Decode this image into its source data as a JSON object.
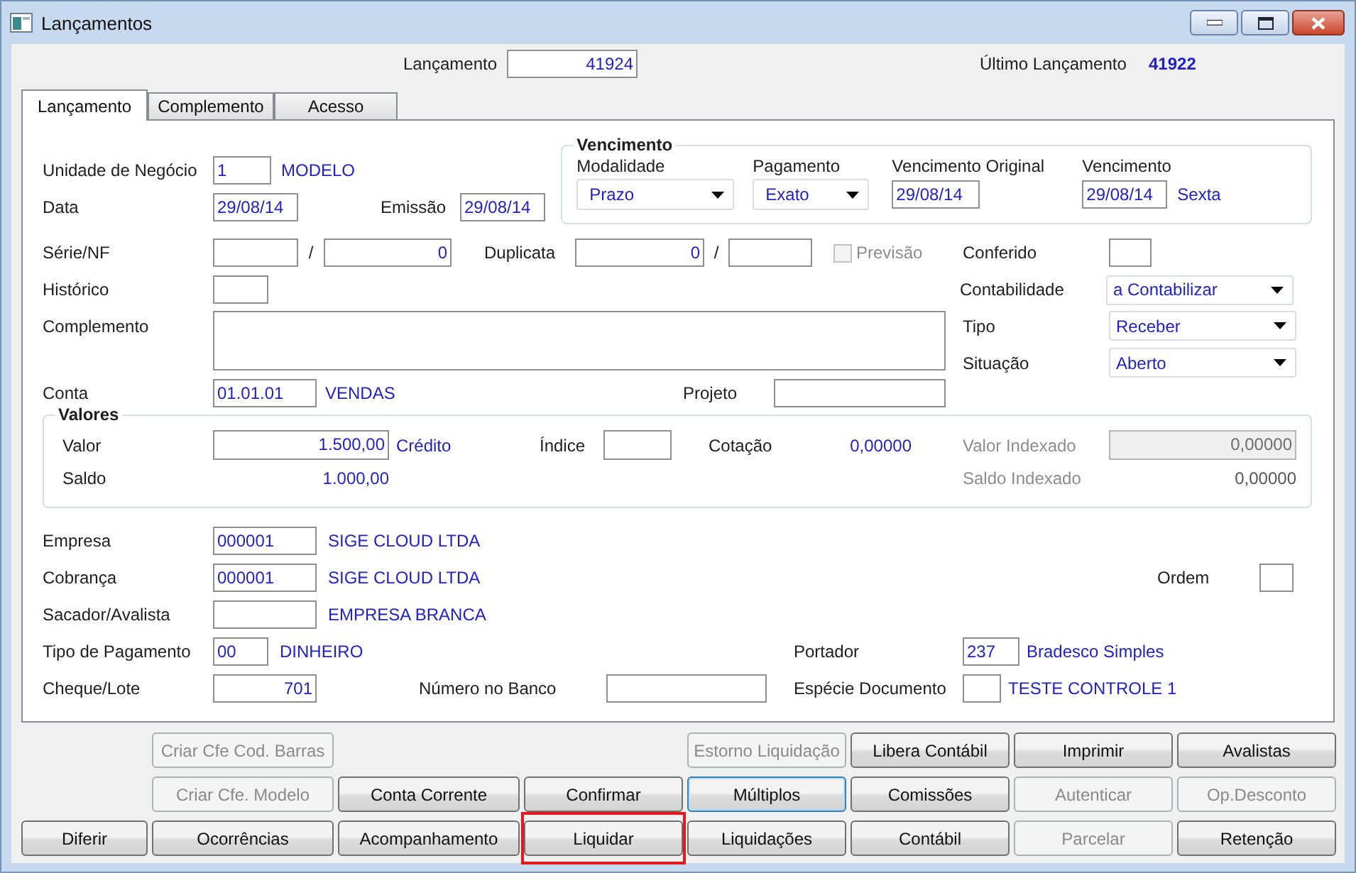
{
  "window": {
    "title": "Lançamentos"
  },
  "header": {
    "entry_label": "Lançamento",
    "entry_value": "41924",
    "last_label": "Último Lançamento",
    "last_value": "41922"
  },
  "tabs": [
    {
      "label": "Lançamento",
      "selected": true
    },
    {
      "label": "Complemento",
      "selected": false
    },
    {
      "label": "Acesso",
      "selected": false
    }
  ],
  "vencimento": {
    "title": "Vencimento",
    "modalidade_label": "Modalidade",
    "modalidade": "Prazo",
    "pagamento_label": "Pagamento",
    "pagamento": "Exato",
    "original_label": "Vencimento Original",
    "original": "29/08/14",
    "due_label": "Vencimento",
    "due": "29/08/14",
    "weekday": "Sexta"
  },
  "form": {
    "unidade": {
      "label": "Unidade de Negócio",
      "code": "1",
      "name": "MODELO"
    },
    "data": {
      "label": "Data",
      "value": "29/08/14"
    },
    "emissao": {
      "label": "Emissão",
      "value": "29/08/14"
    },
    "serie_nf": {
      "label": "Série/NF",
      "separator": "/",
      "nf": "0"
    },
    "duplicata": {
      "label": "Duplicata",
      "value": "0",
      "separator": "/"
    },
    "previsao": {
      "label": "Previsão",
      "checked": false,
      "disabled": true
    },
    "conferido": {
      "label": "Conferido"
    },
    "historico": {
      "label": "Histórico"
    },
    "contabilidade": {
      "label": "Contabilidade",
      "value": "a Contabilizar"
    },
    "complemento": {
      "label": "Complemento"
    },
    "tipo": {
      "label": "Tipo",
      "value": "Receber"
    },
    "situacao": {
      "label": "Situação",
      "value": "Aberto"
    },
    "conta": {
      "label": "Conta",
      "code": "01.01.01",
      "name": "VENDAS"
    },
    "projeto": {
      "label": "Projeto"
    }
  },
  "valores": {
    "title": "Valores",
    "valor_label": "Valor",
    "valor": "1.500,00",
    "valor_type": "Crédito",
    "indice_label": "Índice",
    "cotacao_label": "Cotação",
    "cotacao": "0,00000",
    "indexado_label": "Valor Indexado",
    "indexado": "0,00000",
    "indexado_disabled": true,
    "saldo_label": "Saldo",
    "saldo": "1.000,00",
    "saldo_indexado_label": "Saldo Indexado",
    "saldo_indexado": "0,00000"
  },
  "parties": {
    "empresa": {
      "label": "Empresa",
      "code": "000001",
      "name": "SIGE CLOUD LTDA"
    },
    "cobranca": {
      "label": "Cobrança",
      "code": "000001",
      "name": "SIGE CLOUD LTDA"
    },
    "ordem": {
      "label": "Ordem"
    },
    "sacador": {
      "label": "Sacador/Avalista",
      "name": "EMPRESA BRANCA"
    },
    "tipo_pagamento": {
      "label": "Tipo de Pagamento",
      "code": "00",
      "name": "DINHEIRO"
    },
    "portador": {
      "label": "Portador",
      "code": "237",
      "name": "Bradesco Simples"
    },
    "cheque": {
      "label": "Cheque/Lote",
      "value": "701"
    },
    "numero_banco": {
      "label": "Número no Banco"
    },
    "especie": {
      "label": "Espécie Documento",
      "name": "TESTE CONTROLE 1"
    }
  },
  "button_rows": [
    [
      {
        "label": "Criar Cfe Cod. Barras",
        "disabled": true,
        "focused": false,
        "highlighted": false
      },
      {
        "label": "Estorno Liquidação",
        "disabled": true,
        "focused": false,
        "highlighted": false
      },
      {
        "label": "Libera Contábil",
        "disabled": false,
        "focused": false,
        "highlighted": false
      },
      {
        "label": "Imprimir",
        "disabled": false,
        "focused": false,
        "highlighted": false
      },
      {
        "label": "Avalistas",
        "disabled": false,
        "focused": false,
        "highlighted": false
      }
    ],
    [
      {
        "label": "Criar Cfe. Modelo",
        "disabled": true,
        "focused": false,
        "highlighted": false
      },
      {
        "label": "Conta Corrente",
        "disabled": false,
        "focused": false,
        "highlighted": false
      },
      {
        "label": "Confirmar",
        "disabled": false,
        "focused": false,
        "highlighted": false
      },
      {
        "label": "Múltiplos",
        "disabled": false,
        "focused": true,
        "highlighted": false
      },
      {
        "label": "Comissões",
        "disabled": false,
        "focused": false,
        "highlighted": false
      },
      {
        "label": "Autenticar",
        "disabled": true,
        "focused": false,
        "highlighted": false
      },
      {
        "label": "Op.Desconto",
        "disabled": true,
        "focused": false,
        "highlighted": false
      }
    ],
    [
      {
        "label": "Diferir",
        "disabled": false,
        "focused": false,
        "highlighted": false
      },
      {
        "label": "Ocorrências",
        "disabled": false,
        "focused": false,
        "highlighted": false
      },
      {
        "label": "Acompanhamento",
        "disabled": false,
        "focused": false,
        "highlighted": false
      },
      {
        "label": "Liquidar",
        "disabled": false,
        "focused": false,
        "highlighted": true
      },
      {
        "label": "Liquidações",
        "disabled": false,
        "focused": false,
        "highlighted": false
      },
      {
        "label": "Contábil",
        "disabled": false,
        "focused": false,
        "highlighted": false
      },
      {
        "label": "Parcelar",
        "disabled": true,
        "focused": false,
        "highlighted": false
      },
      {
        "label": "Retenção",
        "disabled": false,
        "focused": false,
        "highlighted": false
      }
    ]
  ]
}
